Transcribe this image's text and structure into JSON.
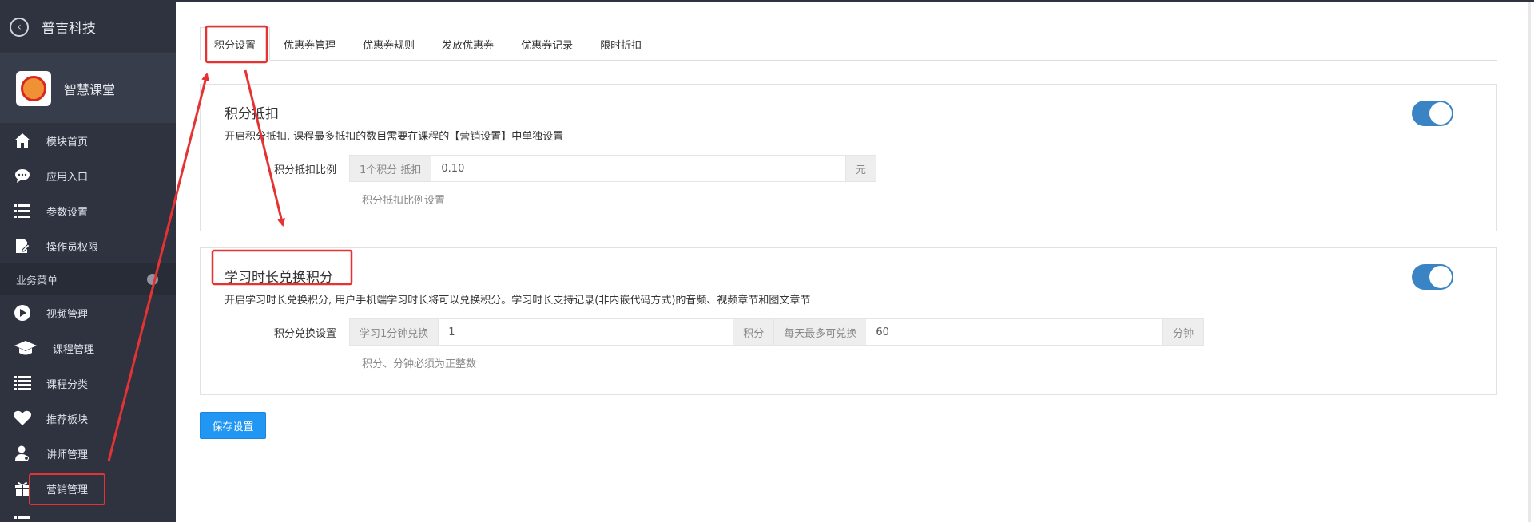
{
  "sidebar": {
    "company": "普吉科技",
    "app_name": "智慧课堂",
    "items_top": [
      {
        "label": "模块首页",
        "icon": "home-icon"
      },
      {
        "label": "应用入口",
        "icon": "chat-icon"
      },
      {
        "label": "参数设置",
        "icon": "list-settings-icon"
      },
      {
        "label": "操作员权限",
        "icon": "edit-document-icon"
      }
    ],
    "group_label": "业务菜单",
    "items_business": [
      {
        "label": "视频管理",
        "icon": "play-icon"
      },
      {
        "label": "课程管理",
        "icon": "graduation-cap-icon"
      },
      {
        "label": "课程分类",
        "icon": "list-icon"
      },
      {
        "label": "推荐板块",
        "icon": "heart-icon"
      },
      {
        "label": "讲师管理",
        "icon": "teacher-icon"
      },
      {
        "label": "营销管理",
        "icon": "gift-icon",
        "active": true
      }
    ]
  },
  "tabs": [
    "积分设置",
    "优惠券管理",
    "优惠券规则",
    "发放优惠券",
    "优惠券记录",
    "限时折扣"
  ],
  "points_deduction": {
    "title": "积分抵扣",
    "description": "开启积分抵扣, 课程最多抵扣的数目需要在课程的【营销设置】中单独设置",
    "enabled": true,
    "label": "积分抵扣比例",
    "prefix": "1个积分 抵扣",
    "value": "0.10",
    "suffix": "元",
    "help": "积分抵扣比例设置"
  },
  "study_exchange": {
    "title": "学习时长兑换积分",
    "description": "开启学习时长兑换积分, 用户手机端学习时长将可以兑换积分。学习时长支持记录(非内嵌代码方式)的音频、视频章节和图文章节",
    "enabled": true,
    "label": "积分兑换设置",
    "prefix1": "学习1分钟兑换",
    "value1": "1",
    "unit1": "积分",
    "prefix2": "每天最多可兑换",
    "value2": "60",
    "unit2": "分钟",
    "help": "积分、分钟必须为正整数"
  },
  "save_label": "保存设置",
  "colors": {
    "sidebar": "#2f3340",
    "toggle": "#3a84c6",
    "primary": "#2196f3",
    "annotation": "#e53333"
  }
}
